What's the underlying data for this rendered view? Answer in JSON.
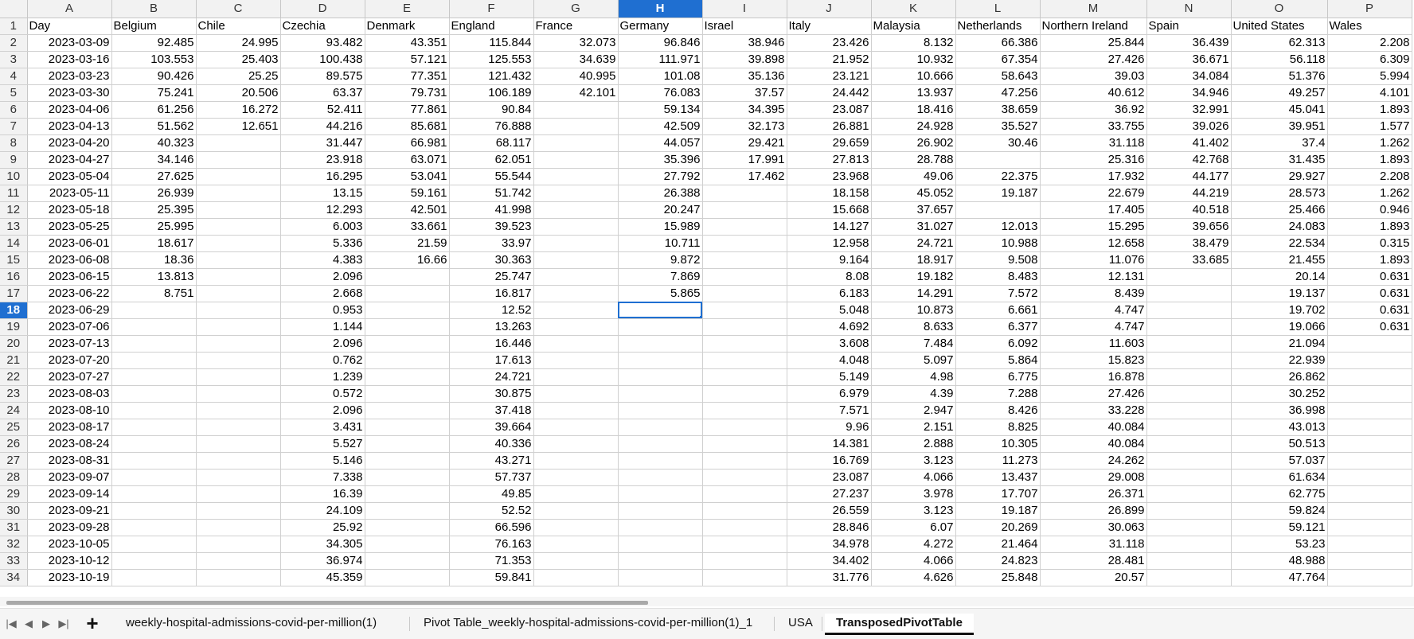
{
  "column_letters": [
    "A",
    "B",
    "C",
    "D",
    "E",
    "F",
    "G",
    "H",
    "I",
    "J",
    "K",
    "L",
    "M",
    "N",
    "O",
    "P"
  ],
  "selected_column": "H",
  "selected_row": 18,
  "columns": [
    "Day",
    "Belgium",
    "Chile",
    "Czechia",
    "Denmark",
    "England",
    "France",
    "Germany",
    "Israel",
    "Italy",
    "Malaysia",
    "Netherlands",
    "Northern Ireland",
    "Spain",
    "United States",
    "Wales"
  ],
  "rows": [
    [
      "2023-03-09",
      "92.485",
      "24.995",
      "93.482",
      "43.351",
      "115.844",
      "32.073",
      "96.846",
      "38.946",
      "23.426",
      "8.132",
      "66.386",
      "25.844",
      "36.439",
      "62.313",
      "2.208"
    ],
    [
      "2023-03-16",
      "103.553",
      "25.403",
      "100.438",
      "57.121",
      "125.553",
      "34.639",
      "111.971",
      "39.898",
      "21.952",
      "10.932",
      "67.354",
      "27.426",
      "36.671",
      "56.118",
      "6.309"
    ],
    [
      "2023-03-23",
      "90.426",
      "25.25",
      "89.575",
      "77.351",
      "121.432",
      "40.995",
      "101.08",
      "35.136",
      "23.121",
      "10.666",
      "58.643",
      "39.03",
      "34.084",
      "51.376",
      "5.994"
    ],
    [
      "2023-03-30",
      "75.241",
      "20.506",
      "63.37",
      "79.731",
      "106.189",
      "42.101",
      "76.083",
      "37.57",
      "24.442",
      "13.937",
      "47.256",
      "40.612",
      "34.946",
      "49.257",
      "4.101"
    ],
    [
      "2023-04-06",
      "61.256",
      "16.272",
      "52.411",
      "77.861",
      "90.84",
      "",
      "59.134",
      "34.395",
      "23.087",
      "18.416",
      "38.659",
      "36.92",
      "32.991",
      "45.041",
      "1.893"
    ],
    [
      "2023-04-13",
      "51.562",
      "12.651",
      "44.216",
      "85.681",
      "76.888",
      "",
      "42.509",
      "32.173",
      "26.881",
      "24.928",
      "35.527",
      "33.755",
      "39.026",
      "39.951",
      "1.577"
    ],
    [
      "2023-04-20",
      "40.323",
      "",
      "31.447",
      "66.981",
      "68.117",
      "",
      "44.057",
      "29.421",
      "29.659",
      "26.902",
      "30.46",
      "31.118",
      "41.402",
      "37.4",
      "1.262"
    ],
    [
      "2023-04-27",
      "34.146",
      "",
      "23.918",
      "63.071",
      "62.051",
      "",
      "35.396",
      "17.991",
      "27.813",
      "28.788",
      "",
      "25.316",
      "42.768",
      "31.435",
      "1.893"
    ],
    [
      "2023-05-04",
      "27.625",
      "",
      "16.295",
      "53.041",
      "55.544",
      "",
      "27.792",
      "17.462",
      "23.968",
      "49.06",
      "22.375",
      "17.932",
      "44.177",
      "29.927",
      "2.208"
    ],
    [
      "2023-05-11",
      "26.939",
      "",
      "13.15",
      "59.161",
      "51.742",
      "",
      "26.388",
      "",
      "18.158",
      "45.052",
      "19.187",
      "22.679",
      "44.219",
      "28.573",
      "1.262"
    ],
    [
      "2023-05-18",
      "25.395",
      "",
      "12.293",
      "42.501",
      "41.998",
      "",
      "20.247",
      "",
      "15.668",
      "37.657",
      "",
      "17.405",
      "40.518",
      "25.466",
      "0.946"
    ],
    [
      "2023-05-25",
      "25.995",
      "",
      "6.003",
      "33.661",
      "39.523",
      "",
      "15.989",
      "",
      "14.127",
      "31.027",
      "12.013",
      "15.295",
      "39.656",
      "24.083",
      "1.893"
    ],
    [
      "2023-06-01",
      "18.617",
      "",
      "5.336",
      "21.59",
      "33.97",
      "",
      "10.711",
      "",
      "12.958",
      "24.721",
      "10.988",
      "12.658",
      "38.479",
      "22.534",
      "0.315"
    ],
    [
      "2023-06-08",
      "18.36",
      "",
      "4.383",
      "16.66",
      "30.363",
      "",
      "9.872",
      "",
      "9.164",
      "18.917",
      "9.508",
      "11.076",
      "33.685",
      "21.455",
      "1.893"
    ],
    [
      "2023-06-15",
      "13.813",
      "",
      "2.096",
      "",
      "25.747",
      "",
      "7.869",
      "",
      "8.08",
      "19.182",
      "8.483",
      "12.131",
      "",
      "20.14",
      "0.631"
    ],
    [
      "2023-06-22",
      "8.751",
      "",
      "2.668",
      "",
      "16.817",
      "",
      "5.865",
      "",
      "6.183",
      "14.291",
      "7.572",
      "8.439",
      "",
      "19.137",
      "0.631"
    ],
    [
      "2023-06-29",
      "",
      "",
      "0.953",
      "",
      "12.52",
      "",
      "",
      "",
      "5.048",
      "10.873",
      "6.661",
      "4.747",
      "",
      "19.702",
      "0.631"
    ],
    [
      "2023-07-06",
      "",
      "",
      "1.144",
      "",
      "13.263",
      "",
      "",
      "",
      "4.692",
      "8.633",
      "6.377",
      "4.747",
      "",
      "19.066",
      "0.631"
    ],
    [
      "2023-07-13",
      "",
      "",
      "2.096",
      "",
      "16.446",
      "",
      "",
      "",
      "3.608",
      "7.484",
      "6.092",
      "11.603",
      "",
      "21.094",
      ""
    ],
    [
      "2023-07-20",
      "",
      "",
      "0.762",
      "",
      "17.613",
      "",
      "",
      "",
      "4.048",
      "5.097",
      "5.864",
      "15.823",
      "",
      "22.939",
      ""
    ],
    [
      "2023-07-27",
      "",
      "",
      "1.239",
      "",
      "24.721",
      "",
      "",
      "",
      "5.149",
      "4.98",
      "6.775",
      "16.878",
      "",
      "26.862",
      ""
    ],
    [
      "2023-08-03",
      "",
      "",
      "0.572",
      "",
      "30.875",
      "",
      "",
      "",
      "6.979",
      "4.39",
      "7.288",
      "27.426",
      "",
      "30.252",
      ""
    ],
    [
      "2023-08-10",
      "",
      "",
      "2.096",
      "",
      "37.418",
      "",
      "",
      "",
      "7.571",
      "2.947",
      "8.426",
      "33.228",
      "",
      "36.998",
      ""
    ],
    [
      "2023-08-17",
      "",
      "",
      "3.431",
      "",
      "39.664",
      "",
      "",
      "",
      "9.96",
      "2.151",
      "8.825",
      "40.084",
      "",
      "43.013",
      ""
    ],
    [
      "2023-08-24",
      "",
      "",
      "5.527",
      "",
      "40.336",
      "",
      "",
      "",
      "14.381",
      "2.888",
      "10.305",
      "40.084",
      "",
      "50.513",
      ""
    ],
    [
      "2023-08-31",
      "",
      "",
      "5.146",
      "",
      "43.271",
      "",
      "",
      "",
      "16.769",
      "3.123",
      "11.273",
      "24.262",
      "",
      "57.037",
      ""
    ],
    [
      "2023-09-07",
      "",
      "",
      "7.338",
      "",
      "57.737",
      "",
      "",
      "",
      "23.087",
      "4.066",
      "13.437",
      "29.008",
      "",
      "61.634",
      ""
    ],
    [
      "2023-09-14",
      "",
      "",
      "16.39",
      "",
      "49.85",
      "",
      "",
      "",
      "27.237",
      "3.978",
      "17.707",
      "26.371",
      "",
      "62.775",
      ""
    ],
    [
      "2023-09-21",
      "",
      "",
      "24.109",
      "",
      "52.52",
      "",
      "",
      "",
      "26.559",
      "3.123",
      "19.187",
      "26.899",
      "",
      "59.824",
      ""
    ],
    [
      "2023-09-28",
      "",
      "",
      "25.92",
      "",
      "66.596",
      "",
      "",
      "",
      "28.846",
      "6.07",
      "20.269",
      "30.063",
      "",
      "59.121",
      ""
    ],
    [
      "2023-10-05",
      "",
      "",
      "34.305",
      "",
      "76.163",
      "",
      "",
      "",
      "34.978",
      "4.272",
      "21.464",
      "31.118",
      "",
      "53.23",
      ""
    ],
    [
      "2023-10-12",
      "",
      "",
      "36.974",
      "",
      "71.353",
      "",
      "",
      "",
      "34.402",
      "4.066",
      "24.823",
      "28.481",
      "",
      "48.988",
      ""
    ],
    [
      "2023-10-19",
      "",
      "",
      "45.359",
      "",
      "59.841",
      "",
      "",
      "",
      "31.776",
      "4.626",
      "25.848",
      "20.57",
      "",
      "47.764",
      ""
    ]
  ],
  "tab_nav": {
    "first_icon": "|◀",
    "prev_icon": "◀",
    "next_icon": "▶",
    "last_icon": "▶|",
    "add_icon": "+"
  },
  "sheet_tabs": [
    {
      "label": "weekly-hospital-admissions-covid-per-million(1)",
      "active": false
    },
    {
      "label": "Pivot Table_weekly-hospital-admissions-covid-per-million(1)_1",
      "active": false
    },
    {
      "label": "USA",
      "active": false
    },
    {
      "label": "TransposedPivotTable",
      "active": true
    }
  ],
  "colors": {
    "selection": "#1f6fd1",
    "header_bg": "#f2f2f2",
    "grid_line": "#d0d0d0"
  }
}
